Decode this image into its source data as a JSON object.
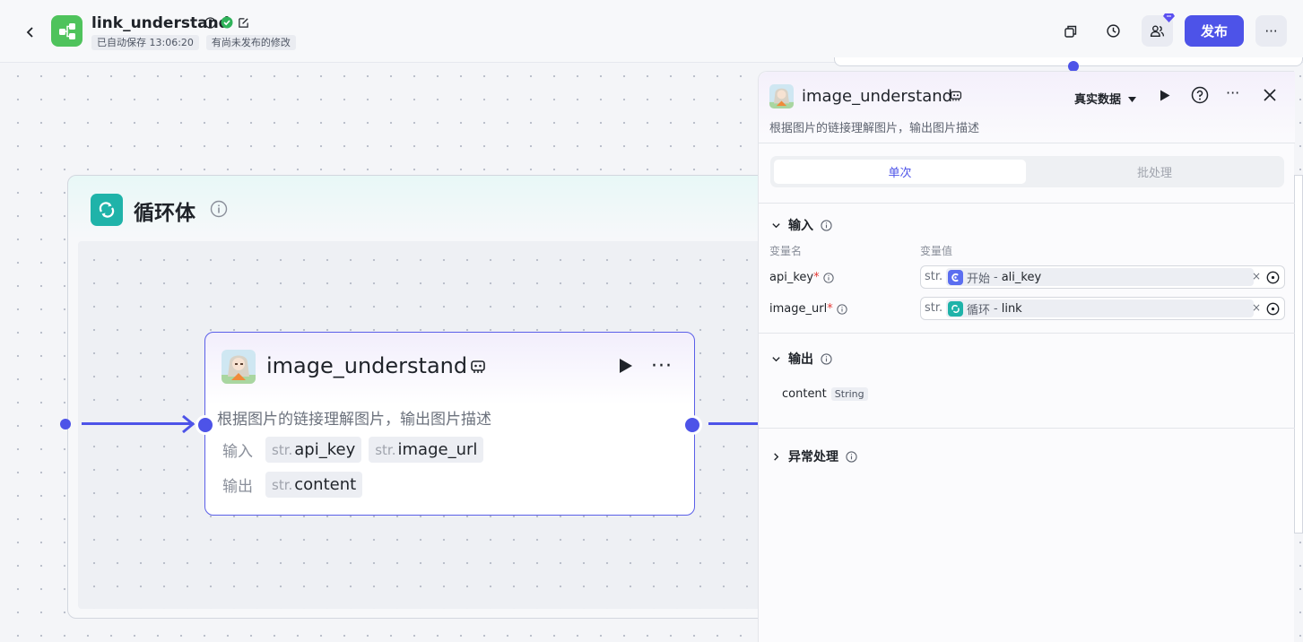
{
  "header": {
    "back_icon": "chevron-left-icon",
    "app_title": "link_understand",
    "autosave": "已自动保存 13:06:20",
    "unpublished": "有尚未发布的修改",
    "publish_label": "发布",
    "more_label": "···"
  },
  "loop": {
    "title": "循环体"
  },
  "node": {
    "title": "image_understand",
    "description": "根据图片的链接理解图片，输出图片描述",
    "input_label": "输入",
    "output_label": "输出",
    "more_label": "···",
    "type_prefix": "str.",
    "inputs": [
      "api_key",
      "image_url"
    ],
    "outputs": [
      "content"
    ]
  },
  "panel": {
    "title": "image_understand",
    "description": "根据图片的链接理解图片，输出图片描述",
    "data_source": "真实数据",
    "tabs": [
      "单次",
      "批处理"
    ],
    "input_section": "输入",
    "col_name": "变量名",
    "col_value": "变量值",
    "vars": [
      {
        "name": "api_key",
        "required": "*",
        "type": "str.",
        "src": "开始",
        "sep": " - ",
        "ref": "ali_key",
        "clear": "×"
      },
      {
        "name": "image_url",
        "required": "*",
        "type": "str.",
        "src": "循环",
        "sep": " - ",
        "ref": "link",
        "clear": "×"
      }
    ],
    "output_section": "输出",
    "output_name": "content",
    "output_type": "String",
    "error_section": "异常处理"
  },
  "colors": {
    "accent": "#4d53e8",
    "loop": "#1fb3a9",
    "app_logo": "#4fc35c"
  }
}
